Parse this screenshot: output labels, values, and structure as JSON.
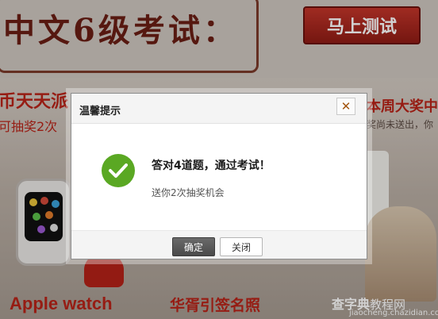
{
  "background": {
    "banner_title": "中文6级考试：",
    "test_button": "马上测试",
    "left_heading": "币天天派",
    "left_sub": "可抽奖2次",
    "right_heading": "本周大奖中",
    "right_sub": "奖尚未送出，你",
    "prize_left": "Apple watch",
    "prize_right": "华胥引签名照",
    "site_logo": "查字典",
    "site_logo_suffix": "教程网",
    "site_url": "jiaocheng.chazidian.com"
  },
  "dialog": {
    "title": "温馨提示",
    "close_glyph": "✕",
    "heading": "答对4道题，通过考试！",
    "subtext": "送你2次抽奖机会",
    "ok_label": "确定",
    "close_label": "关闭",
    "icon": "check-circle-icon",
    "icon_color": "#5aa823"
  }
}
